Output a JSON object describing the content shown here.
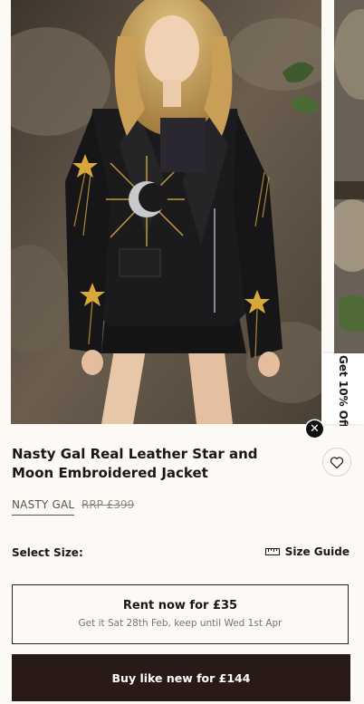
{
  "gallery": {
    "promo_tab": "Get 10% Off"
  },
  "product": {
    "title": "Nasty Gal Real Leather Star and Moon Embroidered Jacket",
    "brand": "NASTY GAL",
    "rrp": "RRP £399"
  },
  "size": {
    "label": "Select Size:",
    "guide_label": "Size Guide"
  },
  "rent": {
    "title": "Rent now for £35",
    "subtitle": "Get it Sat 28th Feb, keep until Wed 1st Apr"
  },
  "buy": {
    "label": "Buy like new for £144"
  },
  "icons": {
    "close": "close-icon",
    "wishlist": "heart-icon",
    "size_guide": "ruler-icon"
  },
  "colors": {
    "background": "#fdfaf5",
    "text": "#1c1613",
    "button": "#2a1a17"
  }
}
